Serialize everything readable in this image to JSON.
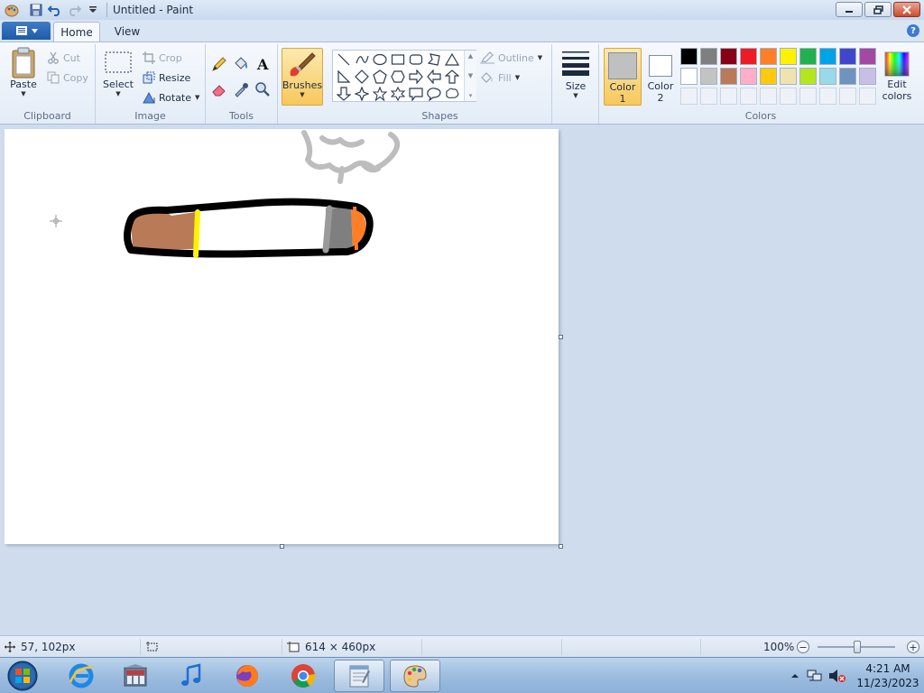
{
  "window": {
    "title": "Untitled - Paint"
  },
  "tabs": {
    "home": "Home",
    "view": "View"
  },
  "ribbon": {
    "clipboard": {
      "label": "Clipboard",
      "paste": "Paste",
      "cut": "Cut",
      "copy": "Copy"
    },
    "image": {
      "label": "Image",
      "select": "Select",
      "crop": "Crop",
      "resize": "Resize",
      "rotate": "Rotate"
    },
    "tools": {
      "label": "Tools"
    },
    "brushes": {
      "label": "Brushes"
    },
    "shapes": {
      "label": "Shapes",
      "outline": "Outline",
      "fill": "Fill"
    },
    "size": {
      "label": "Size"
    },
    "colors": {
      "label": "Colors",
      "color1_line1": "Color",
      "color1_line2": "1",
      "color2_line1": "Color",
      "color2_line2": "2",
      "edit_line1": "Edit",
      "edit_line2": "colors",
      "color1_value": "#c0c0c0",
      "color2_value": "#ffffff",
      "palette_row1": [
        "#000000",
        "#7f7f7f",
        "#880015",
        "#ed1c24",
        "#ff7f27",
        "#fff200",
        "#22b14c",
        "#00a2e8",
        "#3f48cc",
        "#a349a4"
      ],
      "palette_row2": [
        "#ffffff",
        "#c3c3c3",
        "#b97a57",
        "#ffaec9",
        "#ffc90e",
        "#efe4b0",
        "#b5e61d",
        "#99d9ea",
        "#7092be",
        "#c8bfe7"
      ]
    }
  },
  "status": {
    "cursor_pos": "57, 102px",
    "canvas_size": "614 × 460px",
    "zoom": "100%"
  },
  "taskbar": {
    "time": "4:21 AM",
    "date": "11/23/2023"
  }
}
